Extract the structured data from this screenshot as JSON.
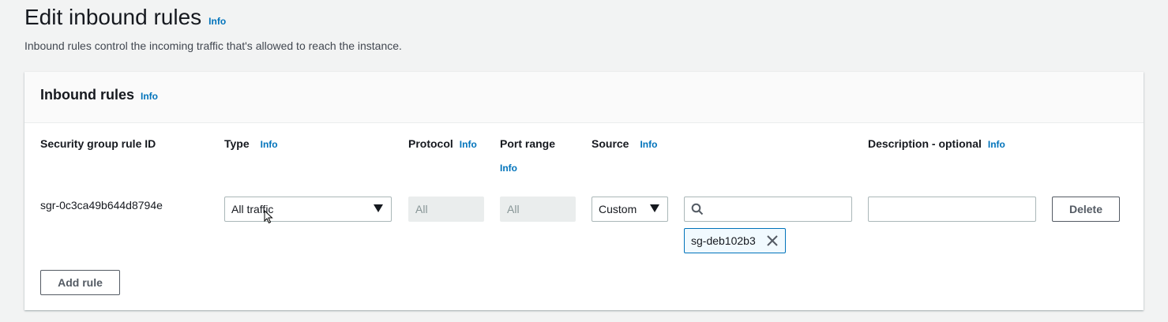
{
  "page": {
    "title": "Edit inbound rules",
    "title_info": "Info",
    "description": "Inbound rules control the incoming traffic that's allowed to reach the instance."
  },
  "panel": {
    "title": "Inbound rules",
    "title_info": "Info",
    "columns": {
      "rule_id": "Security group rule ID",
      "type": "Type",
      "type_info": "Info",
      "protocol": "Protocol",
      "protocol_info": "Info",
      "port_range": "Port range",
      "port_range_info": "Info",
      "source": "Source",
      "source_info": "Info",
      "description": "Description - optional",
      "description_info": "Info"
    },
    "rules": [
      {
        "id": "sgr-0c3ca49b644d8794e",
        "type": "All traffic",
        "protocol": "All",
        "port_range": "All",
        "source_type": "Custom",
        "source_search": "",
        "source_token": "sg-deb102b3",
        "description": "",
        "delete_label": "Delete"
      }
    ],
    "add_rule_label": "Add rule"
  },
  "icons": {
    "search": "search-icon",
    "dropdown": "caret-down-icon",
    "remove_token": "close-icon"
  },
  "colors": {
    "link": "#0073bb",
    "background": "#f2f3f3",
    "token_border": "#0073bb"
  }
}
